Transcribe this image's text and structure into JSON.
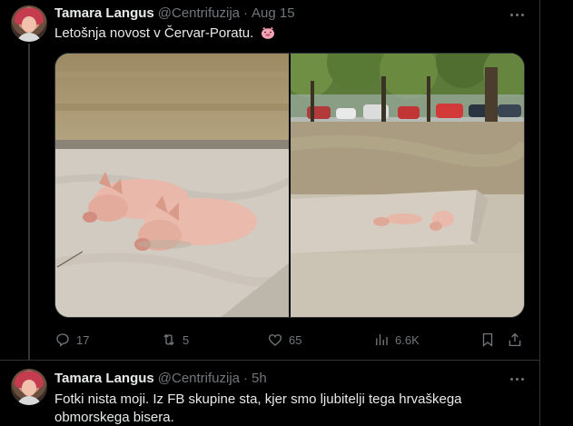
{
  "tweets": [
    {
      "author_name": "Tamara Langus",
      "handle": "@Centrifuzija",
      "separator": "·",
      "time": "Aug 15",
      "text": "Letošnja novost v Červar-Poratu.",
      "emoji": "pig-face",
      "media": [
        "pigs-lying-in-sand",
        "pigs-under-trees-parking-lot"
      ],
      "stats": {
        "replies": "17",
        "reposts": "5",
        "likes": "65",
        "views": "6.6K"
      }
    },
    {
      "author_name": "Tamara Langus",
      "handle": "@Centrifuzija",
      "separator": "·",
      "time": "5h",
      "text": "Fotki nista moji. Iz FB skupine sta, kjer smo ljubitelji tega hrvaškega obmorskega bisera."
    }
  ],
  "colors": {
    "background": "#000000",
    "text_primary": "#e7e9ea",
    "text_secondary": "#71767b",
    "border": "#2f3336"
  }
}
